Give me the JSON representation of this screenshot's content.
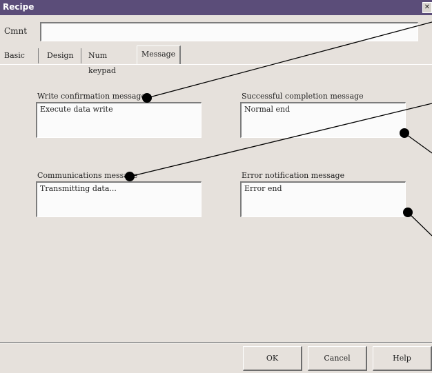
{
  "window": {
    "title": "Recipe",
    "close_glyph": "✕"
  },
  "comment": {
    "label": "Cmnt",
    "value": ""
  },
  "tabs": [
    {
      "label": "Basic"
    },
    {
      "label": "Design"
    },
    {
      "label": "Num keypad"
    },
    {
      "label": "Message",
      "active": true
    }
  ],
  "fields": {
    "write_confirmation": {
      "label": "Write confirmation message",
      "value": "Execute data write"
    },
    "successful_completion": {
      "label": "Successful completion message",
      "value": "Normal end"
    },
    "communications": {
      "label": "Communications message",
      "value": "Transmitting data..."
    },
    "error_notification": {
      "label": "Error notification message",
      "value": "Error end"
    }
  },
  "buttons": {
    "ok": "OK",
    "cancel": "Cancel",
    "help": "Help"
  }
}
